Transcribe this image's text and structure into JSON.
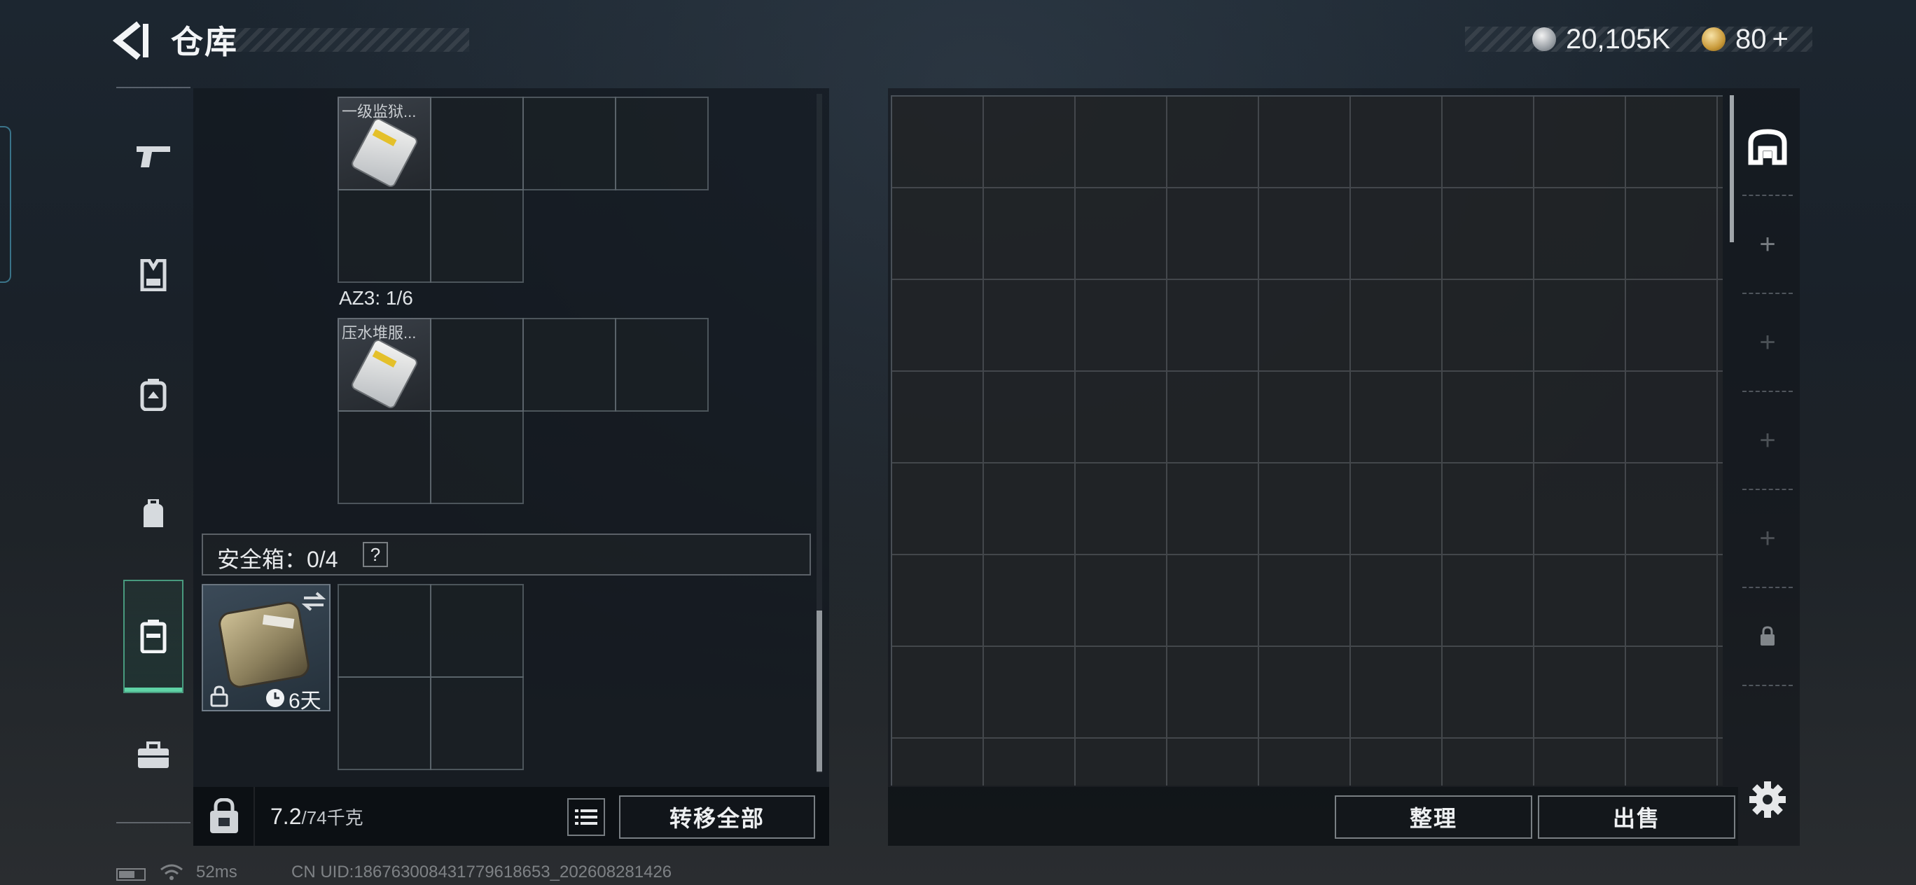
{
  "header": {
    "title": "仓库",
    "silver_amount": "20,105K",
    "gold_amount": "80",
    "gold_plus": "+"
  },
  "nav": {
    "items": [
      {
        "name": "weapons",
        "icon": "pistol-icon"
      },
      {
        "name": "armor",
        "icon": "vest-icon"
      },
      {
        "name": "backpack",
        "icon": "backpack-icon"
      },
      {
        "name": "pouch",
        "icon": "pouch-icon"
      },
      {
        "name": "safe-case",
        "icon": "safe-case-icon",
        "active": true
      },
      {
        "name": "toolbox",
        "icon": "briefcase-icon"
      }
    ]
  },
  "storage": {
    "containers": [
      {
        "item_name": "一级监狱...",
        "item_icon": "keycard-icon"
      },
      {
        "label": "AZ3: 1/6",
        "item_name": "压水堆服...",
        "item_icon": "keycard-icon"
      }
    ],
    "safe_box": {
      "label": "安全箱：0/4",
      "help": "?",
      "duration": "6天"
    }
  },
  "footer_left": {
    "weight_value": "7.2",
    "weight_max": "/74千克",
    "transfer_all": "转移全部"
  },
  "footer_right": {
    "sort": "整理",
    "sell": "出售"
  },
  "tabs": [
    {
      "icon": "stash-home-icon",
      "active": true
    },
    {
      "label": "+"
    },
    {
      "label": "+"
    },
    {
      "label": "+"
    },
    {
      "label": "+"
    },
    {
      "icon": "lock-icon"
    }
  ],
  "status_bar": {
    "ping": "52ms",
    "uid": "CN UID:18676300843177961​8653_202608281426"
  },
  "colors": {
    "accent_green": "#5fd3a6",
    "gold": "#c99a3a"
  }
}
